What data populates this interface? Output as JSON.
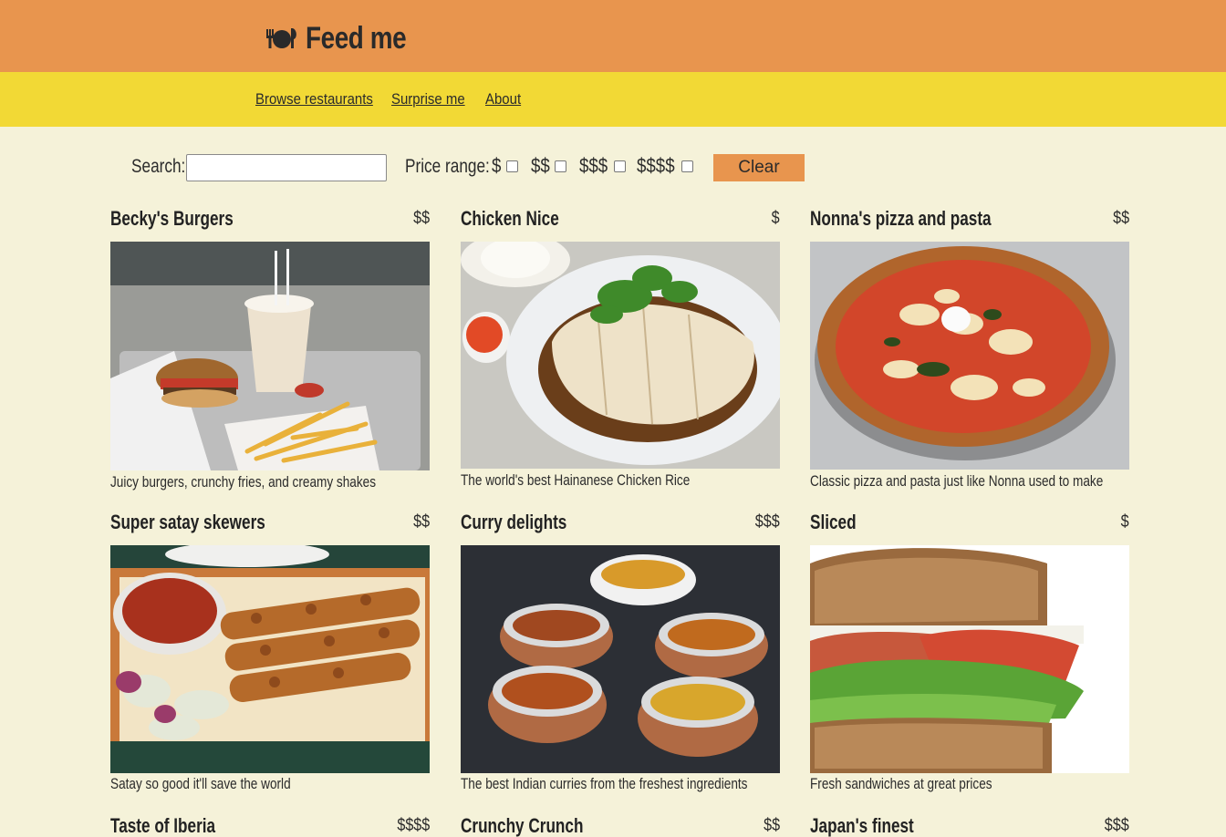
{
  "header": {
    "icon": "plate-cutlery-icon",
    "title": "Feed me"
  },
  "nav": {
    "browse": "Browse restaurants",
    "surprise": "Surprise me",
    "about": "About"
  },
  "filters": {
    "search_label": "Search:",
    "search_value": "",
    "price_label": "Price range:",
    "price_options": [
      "$",
      "$$",
      "$$$",
      "$$$$"
    ],
    "clear_label": "Clear"
  },
  "restaurants": [
    {
      "name": "Becky's Burgers",
      "price": "$$",
      "description": "Juicy burgers, crunchy fries, and creamy shakes",
      "image": "burger-meal-photo"
    },
    {
      "name": "Chicken Nice",
      "price": "$",
      "description": "The world's best Hainanese Chicken Rice",
      "image": "chicken-rice-photo"
    },
    {
      "name": "Nonna's pizza and pasta",
      "price": "$$",
      "description": "Classic pizza and pasta just like Nonna used to make",
      "image": "pizza-photo"
    },
    {
      "name": "Super satay skewers",
      "price": "$$",
      "description": "Satay so good it'll save the world",
      "image": "satay-photo"
    },
    {
      "name": "Curry delights",
      "price": "$$$",
      "description": "The best Indian curries from the freshest ingredients",
      "image": "curry-bowls-photo"
    },
    {
      "name": "Sliced",
      "price": "$",
      "description": "Fresh sandwiches at great prices",
      "image": "sandwich-photo"
    },
    {
      "name": "Taste of Iberia",
      "price": "$$$$"
    },
    {
      "name": "Crunchy Crunch",
      "price": "$$"
    },
    {
      "name": "Japan's finest",
      "price": "$$$"
    }
  ],
  "colors": {
    "header_bg": "#e8954e",
    "nav_bg": "#f2d935",
    "page_bg": "#f5f2d9",
    "button_bg": "#e8954e"
  }
}
